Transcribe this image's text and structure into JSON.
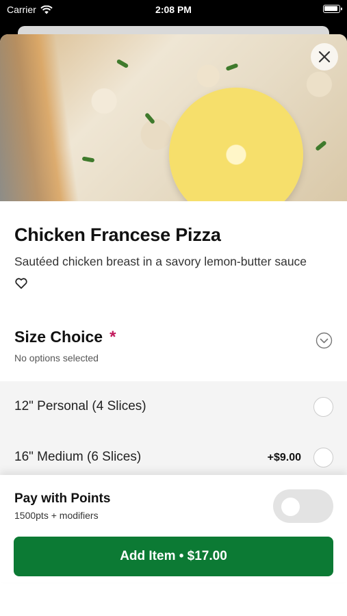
{
  "status_bar": {
    "carrier": "Carrier",
    "time": "2:08 PM"
  },
  "item": {
    "title": "Chicken Francese Pizza",
    "description": "Sautéed chicken breast in a savory lemon-butter sauce"
  },
  "size_choice": {
    "title": "Size Choice",
    "required_mark": "*",
    "subtitle": "No options selected",
    "options": [
      {
        "label": "12\" Personal (4 Slices)",
        "price": ""
      },
      {
        "label": "16\" Medium (6 Slices)",
        "price": "+$9.00"
      }
    ]
  },
  "points": {
    "title": "Pay with Points",
    "subtitle": "1500pts + modifiers",
    "enabled": false
  },
  "add_button": {
    "label": "Add Item • $17.00"
  },
  "colors": {
    "primary": "#0c7a34",
    "required": "#c2185b"
  },
  "icons": [
    "wifi-icon",
    "battery-icon",
    "close-icon",
    "heart-icon",
    "chevron-down-icon"
  ]
}
